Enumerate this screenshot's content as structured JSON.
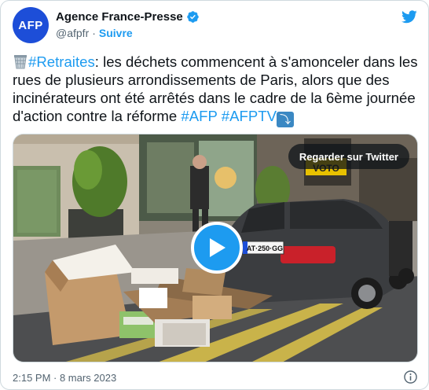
{
  "account": {
    "avatar_text": "AFP",
    "name": "Agence France-Presse",
    "handle": "@afpfr",
    "separator": "·",
    "follow_label": "Suivre"
  },
  "tweet": {
    "hashtag_retraites": "#Retraites",
    "text_body": ": les déchets commencent à s'amonceler dans les rues de plusieurs arrondissements de Paris, alors que des incinérateurs ont été arrêtés dans le cadre de la 6ème journée d'action contre la réforme ",
    "hashtag_afp": "#AFP",
    "hashtag_afptv": "#AFPTV"
  },
  "media": {
    "watch_label": "Regarder sur Twitter",
    "license_plate": "AT·250·GG",
    "sign_text": "VOTO"
  },
  "footer": {
    "timestamp": "2:15 PM · 8 mars 2023"
  },
  "colors": {
    "accent": "#1d9bf0",
    "avatar": "#1d4ed8",
    "muted": "#536471"
  }
}
